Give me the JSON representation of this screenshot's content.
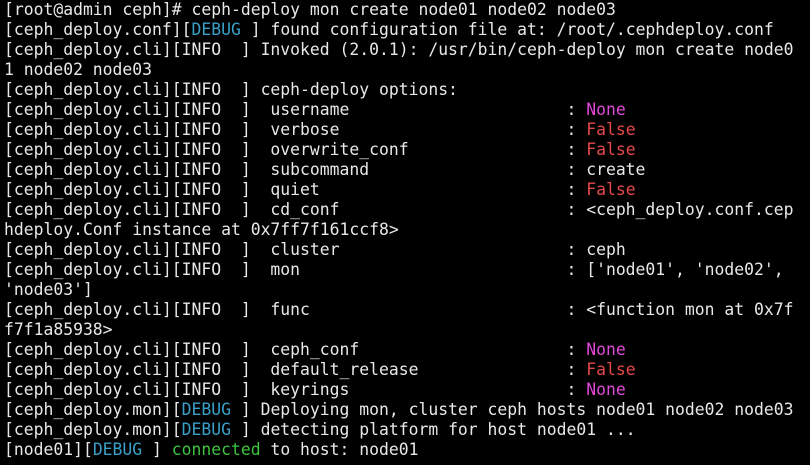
{
  "colors": {
    "background": "#000000",
    "text": "#e8e8e8",
    "debug": "#3aa0c8",
    "none_value": "#e048d8",
    "false_value": "#e84848",
    "connected": "#3ec43e"
  },
  "terminal": {
    "lines": [
      {
        "segments": [
          {
            "text": "[root@admin ceph]# ceph-deploy mon create node01 node02 node03",
            "style": "plain"
          }
        ]
      },
      {
        "segments": [
          {
            "text": "[ceph_deploy.conf][",
            "style": "plain"
          },
          {
            "text": "DEBUG",
            "style": "debug"
          },
          {
            "text": " ] found configuration file at: /root/.cephdeploy.conf",
            "style": "plain"
          }
        ]
      },
      {
        "segments": [
          {
            "text": "[ceph_deploy.cli][INFO  ] Invoked (2.0.1): /usr/bin/ceph-deploy mon create node0",
            "style": "plain"
          }
        ]
      },
      {
        "segments": [
          {
            "text": "1 node02 node03",
            "style": "plain"
          }
        ]
      },
      {
        "segments": [
          {
            "text": "[ceph_deploy.cli][INFO  ] ceph-deploy options:",
            "style": "plain"
          }
        ]
      },
      {
        "segments": [
          {
            "text": "[ceph_deploy.cli][INFO  ]  username                      : ",
            "style": "plain"
          },
          {
            "text": "None",
            "style": "none"
          }
        ]
      },
      {
        "segments": [
          {
            "text": "[ceph_deploy.cli][INFO  ]  verbose                       : ",
            "style": "plain"
          },
          {
            "text": "False",
            "style": "false"
          }
        ]
      },
      {
        "segments": [
          {
            "text": "[ceph_deploy.cli][INFO  ]  overwrite_conf                : ",
            "style": "plain"
          },
          {
            "text": "False",
            "style": "false"
          }
        ]
      },
      {
        "segments": [
          {
            "text": "[ceph_deploy.cli][INFO  ]  subcommand                    : create",
            "style": "plain"
          }
        ]
      },
      {
        "segments": [
          {
            "text": "[ceph_deploy.cli][INFO  ]  quiet                         : ",
            "style": "plain"
          },
          {
            "text": "False",
            "style": "false"
          }
        ]
      },
      {
        "segments": [
          {
            "text": "[ceph_deploy.cli][INFO  ]  cd_conf                       : <ceph_deploy.conf.cep",
            "style": "plain"
          }
        ]
      },
      {
        "segments": [
          {
            "text": "hdeploy.Conf instance at 0x7ff7f161ccf8>",
            "style": "plain"
          }
        ]
      },
      {
        "segments": [
          {
            "text": "[ceph_deploy.cli][INFO  ]  cluster                       : ceph",
            "style": "plain"
          }
        ]
      },
      {
        "segments": [
          {
            "text": "[ceph_deploy.cli][INFO  ]  mon                           : ['node01', 'node02',",
            "style": "plain"
          }
        ]
      },
      {
        "segments": [
          {
            "text": "'node03']",
            "style": "plain"
          }
        ]
      },
      {
        "segments": [
          {
            "text": "[ceph_deploy.cli][INFO  ]  func                          : <function mon at 0x7f",
            "style": "plain"
          }
        ]
      },
      {
        "segments": [
          {
            "text": "f7f1a85938>",
            "style": "plain"
          }
        ]
      },
      {
        "segments": [
          {
            "text": "[ceph_deploy.cli][INFO  ]  ceph_conf                     : ",
            "style": "plain"
          },
          {
            "text": "None",
            "style": "none"
          }
        ]
      },
      {
        "segments": [
          {
            "text": "[ceph_deploy.cli][INFO  ]  default_release               : ",
            "style": "plain"
          },
          {
            "text": "False",
            "style": "false"
          }
        ]
      },
      {
        "segments": [
          {
            "text": "[ceph_deploy.cli][INFO  ]  keyrings                      : ",
            "style": "plain"
          },
          {
            "text": "None",
            "style": "none"
          }
        ]
      },
      {
        "segments": [
          {
            "text": "[ceph_deploy.mon][",
            "style": "plain"
          },
          {
            "text": "DEBUG",
            "style": "debug"
          },
          {
            "text": " ] Deploying mon, cluster ceph hosts node01 node02 node03",
            "style": "plain"
          }
        ]
      },
      {
        "segments": [
          {
            "text": "[ceph_deploy.mon][",
            "style": "plain"
          },
          {
            "text": "DEBUG",
            "style": "debug"
          },
          {
            "text": " ] detecting platform for host node01 ...",
            "style": "plain"
          }
        ]
      },
      {
        "segments": [
          {
            "text": "[node01][",
            "style": "plain"
          },
          {
            "text": "DEBUG",
            "style": "debug"
          },
          {
            "text": " ] ",
            "style": "plain"
          },
          {
            "text": "connected",
            "style": "green"
          },
          {
            "text": " to host: node01",
            "style": "plain"
          }
        ]
      }
    ]
  }
}
